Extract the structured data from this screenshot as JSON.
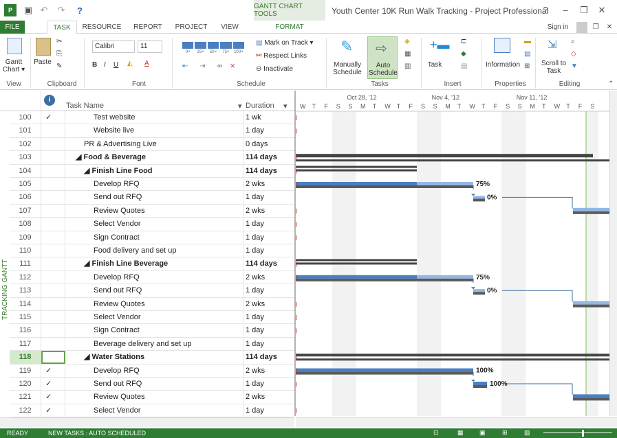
{
  "title_bar": {
    "contextual_tab": "GANTT CHART TOOLS",
    "window_title": "Youth Center 10K Run Walk Tracking - Project Professional",
    "help": "?",
    "minimize": "–",
    "restore": "❐",
    "close": "✕",
    "sign_in": "Sign in"
  },
  "tabs": [
    "FILE",
    "TASK",
    "RESOURCE",
    "REPORT",
    "PROJECT",
    "VIEW",
    "FORMAT"
  ],
  "ribbon": {
    "view_group": {
      "button": "Gantt Chart ▾",
      "label": "View"
    },
    "clipboard_group": {
      "paste": "Paste",
      "label": "Clipboard"
    },
    "font_group": {
      "font_name": "Calibri",
      "font_size": "11",
      "label": "Font"
    },
    "schedule_group": {
      "label": "Schedule",
      "mark_on_track": "Mark on Track",
      "respect_links": "Respect Links",
      "inactivate": "Inactivate",
      "pct_labels": [
        "0×",
        "25×",
        "50×",
        "75×",
        "100×"
      ]
    },
    "tasks_group": {
      "manually": "Manually Schedule",
      "auto": "Auto Schedule",
      "label": "Tasks"
    },
    "insert_group": {
      "task": "Task",
      "label": "Insert"
    },
    "properties_group": {
      "information": "Information",
      "label": "Properties"
    },
    "editing_group": {
      "scroll": "Scroll to Task",
      "label": "Editing"
    }
  },
  "grid": {
    "side_label": "TRACKING GANTT",
    "headers": {
      "task_name": "Task Name",
      "duration": "Duration"
    },
    "rows": [
      {
        "id": "100",
        "done": "✓",
        "name": "Test website",
        "duration": "1 wk",
        "indent": 3,
        "bold": false
      },
      {
        "id": "101",
        "done": "",
        "name": "Website live",
        "duration": "1 day",
        "indent": 3,
        "bold": false
      },
      {
        "id": "102",
        "done": "",
        "name": "PR & Advertising Live",
        "duration": "0 days",
        "indent": 2,
        "bold": false
      },
      {
        "id": "103",
        "done": "",
        "name": "◢ Food & Beverage",
        "duration": "114 days",
        "indent": 1,
        "bold": true
      },
      {
        "id": "104",
        "done": "",
        "name": "◢ Finish Line Food",
        "duration": "114 days",
        "indent": 2,
        "bold": true
      },
      {
        "id": "105",
        "done": "",
        "name": "Develop RFQ",
        "duration": "2 wks",
        "indent": 3,
        "bold": false
      },
      {
        "id": "106",
        "done": "",
        "name": "Send out RFQ",
        "duration": "1 day",
        "indent": 3,
        "bold": false
      },
      {
        "id": "107",
        "done": "",
        "name": "Review Quotes",
        "duration": "2 wks",
        "indent": 3,
        "bold": false
      },
      {
        "id": "108",
        "done": "",
        "name": "Select Vendor",
        "duration": "1 day",
        "indent": 3,
        "bold": false
      },
      {
        "id": "109",
        "done": "",
        "name": "Sign Contract",
        "duration": "1 day",
        "indent": 3,
        "bold": false
      },
      {
        "id": "110",
        "done": "",
        "name": "Food delivery and set up",
        "duration": "1 day",
        "indent": 3,
        "bold": false
      },
      {
        "id": "111",
        "done": "",
        "name": "◢ Finish Line Beverage",
        "duration": "114 days",
        "indent": 2,
        "bold": true
      },
      {
        "id": "112",
        "done": "",
        "name": "Develop RFQ",
        "duration": "2 wks",
        "indent": 3,
        "bold": false
      },
      {
        "id": "113",
        "done": "",
        "name": "Send out RFQ",
        "duration": "1 day",
        "indent": 3,
        "bold": false
      },
      {
        "id": "114",
        "done": "",
        "name": "Review Quotes",
        "duration": "2 wks",
        "indent": 3,
        "bold": false
      },
      {
        "id": "115",
        "done": "",
        "name": "Select Vendor",
        "duration": "1 day",
        "indent": 3,
        "bold": false
      },
      {
        "id": "116",
        "done": "",
        "name": "Sign Contract",
        "duration": "1 day",
        "indent": 3,
        "bold": false
      },
      {
        "id": "117",
        "done": "",
        "name": "Beverage delivery and set up",
        "duration": "1 day",
        "indent": 3,
        "bold": false
      },
      {
        "id": "118",
        "done": "",
        "name": "◢ Water Stations",
        "duration": "114 days",
        "indent": 2,
        "bold": true,
        "selected": true
      },
      {
        "id": "119",
        "done": "✓",
        "name": "Develop RFQ",
        "duration": "2 wks",
        "indent": 3,
        "bold": false
      },
      {
        "id": "120",
        "done": "✓",
        "name": "Send out RFQ",
        "duration": "1 day",
        "indent": 3,
        "bold": false
      },
      {
        "id": "121",
        "done": "✓",
        "name": "Review Quotes",
        "duration": "2 wks",
        "indent": 3,
        "bold": false
      },
      {
        "id": "122",
        "done": "✓",
        "name": "Select Vendor",
        "duration": "1 day",
        "indent": 3,
        "bold": false
      }
    ]
  },
  "timescale": {
    "weeks": [
      "Oct 28, '12",
      "Nov 4, '12",
      "Nov 11, '12"
    ],
    "days": [
      "W",
      "T",
      "F",
      "S",
      "S",
      "M",
      "T",
      "W",
      "T",
      "F",
      "S",
      "S",
      "M",
      "T",
      "W",
      "T",
      "F",
      "S",
      "S",
      "M",
      "T",
      "W",
      "T",
      "F",
      "S"
    ],
    "bar_labels": {
      "r105": "75%",
      "r106": "0%",
      "r112": "75%",
      "r113": "0%",
      "r119": "100%",
      "r120": "100%"
    }
  },
  "status_bar": {
    "ready": "READY",
    "new_tasks": "NEW TASKS : AUTO SCHEDULED"
  },
  "colors": {
    "accent": "#2f7c33",
    "bar_blue": "#4a7fc1",
    "bar_light": "#93b7e4",
    "baseline": "#5a5a5a"
  }
}
